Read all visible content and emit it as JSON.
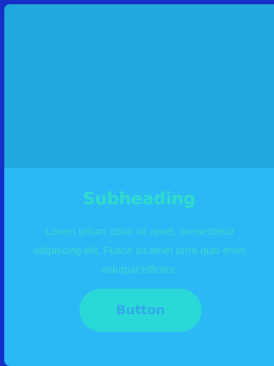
{
  "card": {
    "title": "Subheading",
    "text": "Lorem ipsum dolor sit amet, consectetur adipiscing elit. Fusce sit amet urna quis enim volutpat efficitur.",
    "button_label": "Button"
  },
  "colors": {
    "page_background": "#1530c8",
    "card_background": "#2bb9f6",
    "image_area": "#22a8dd",
    "title": "#2fdccb",
    "body_text": "#3ad8cc",
    "button_background": "#2ad8d8",
    "button_text": "#31a8ea"
  }
}
